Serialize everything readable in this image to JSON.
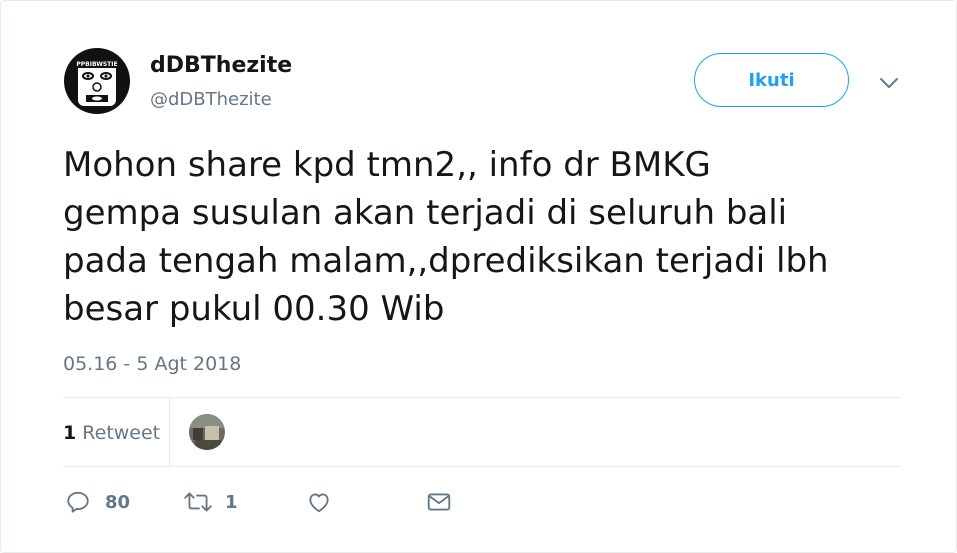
{
  "user": {
    "name": "dDBThezite",
    "handle": "@dDBThezite"
  },
  "follow_label": "Ikuti",
  "tweet": {
    "lines": [
      "Mohon share kpd tmn2,,  info dr BMKG",
      "gempa susulan akan terjadi di seluruh bali",
      "pada tengah malam,,dprediksikan terjadi lbh",
      "besar pukul 00.30 Wib"
    ],
    "timestamp": "05.16 - 5 Agt 2018"
  },
  "stats": {
    "retweet_count": "1",
    "retweet_label": "Retweet"
  },
  "actions": {
    "reply_count": "80",
    "retweet_count": "1",
    "like_count": "",
    "message_count": ""
  },
  "icons": [
    "avatar",
    "chevron-down-icon",
    "reply-icon",
    "retweet-icon",
    "like-icon",
    "message-icon"
  ],
  "colors": {
    "accent": "#1da1f2",
    "text": "#14171a",
    "secondary": "#657786",
    "divider": "#e6ecf0"
  }
}
